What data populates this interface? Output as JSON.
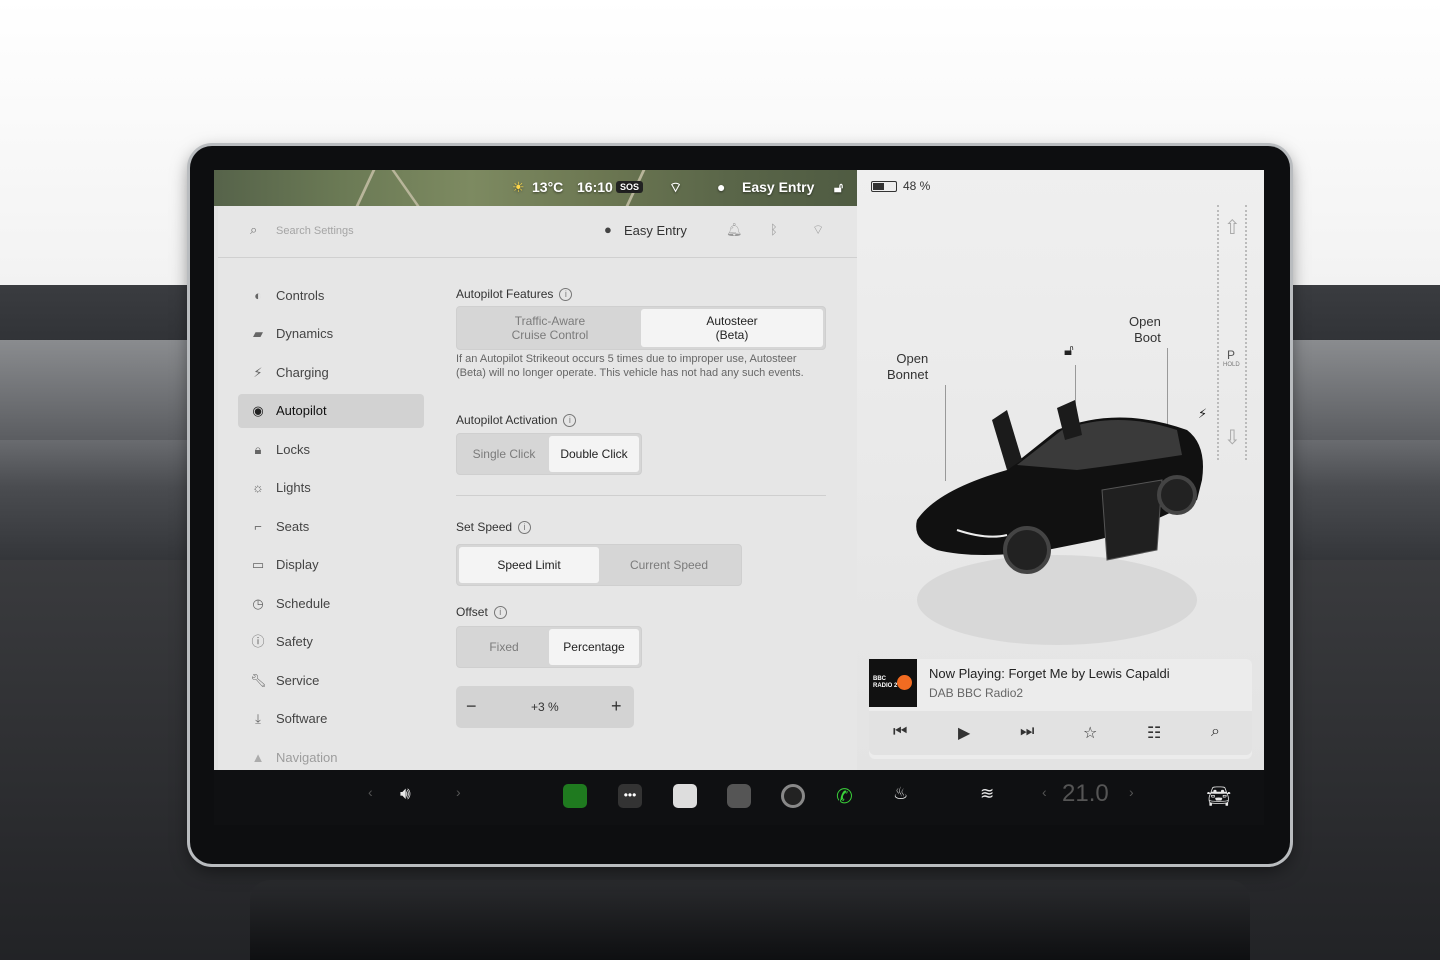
{
  "status_bar": {
    "temperature": "13°C",
    "time": "16:10",
    "sos": "SOS",
    "profile": "Easy Entry"
  },
  "settings": {
    "search_placeholder": "Search Settings",
    "profile_name": "Easy Entry",
    "nav": [
      {
        "label": "Controls",
        "icon": "toggle-icon"
      },
      {
        "label": "Dynamics",
        "icon": "car-icon"
      },
      {
        "label": "Charging",
        "icon": "bolt-icon"
      },
      {
        "label": "Autopilot",
        "icon": "steering-wheel-icon",
        "active": true
      },
      {
        "label": "Locks",
        "icon": "lock-icon"
      },
      {
        "label": "Lights",
        "icon": "light-icon"
      },
      {
        "label": "Seats",
        "icon": "seat-icon"
      },
      {
        "label": "Display",
        "icon": "display-icon"
      },
      {
        "label": "Schedule",
        "icon": "clock-icon"
      },
      {
        "label": "Safety",
        "icon": "safety-icon"
      },
      {
        "label": "Service",
        "icon": "wrench-icon"
      },
      {
        "label": "Software",
        "icon": "download-icon"
      },
      {
        "label": "Navigation",
        "icon": "navigation-icon"
      }
    ],
    "autopilot_features": {
      "title": "Autopilot Features",
      "options": [
        "Traffic-Aware\nCruise Control",
        "Autosteer\n(Beta)"
      ],
      "selected": "Autosteer (Beta)",
      "warning": "If an Autopilot Strikeout occurs 5 times due to improper use, Autosteer (Beta) will no longer operate. This vehicle has not had any such events."
    },
    "autopilot_activation": {
      "title": "Autopilot Activation",
      "options": [
        "Single Click",
        "Double Click"
      ],
      "selected": "Double Click"
    },
    "set_speed": {
      "title": "Set Speed",
      "options": [
        "Speed Limit",
        "Current Speed"
      ],
      "selected": "Speed Limit"
    },
    "offset": {
      "title": "Offset",
      "options": [
        "Fixed",
        "Percentage"
      ],
      "selected": "Percentage",
      "value": "+3 %",
      "minus": "−",
      "plus": "+"
    }
  },
  "car_panel": {
    "battery_percent": 48,
    "battery_text": "48 %",
    "open_bonnet": "Open\nBonnet",
    "open_boot": "Open\nBoot",
    "gear": "P",
    "gear_hold": "HOLD"
  },
  "media": {
    "now_playing": "Now Playing: Forget Me by Lewis Capaldi",
    "source": "DAB BBC Radio2",
    "art_text": "BBC RADIO 2"
  },
  "dock": {
    "temperature": "21.0",
    "colors": {
      "charts": "#3ad23a",
      "phone": "#3ad23a"
    }
  }
}
